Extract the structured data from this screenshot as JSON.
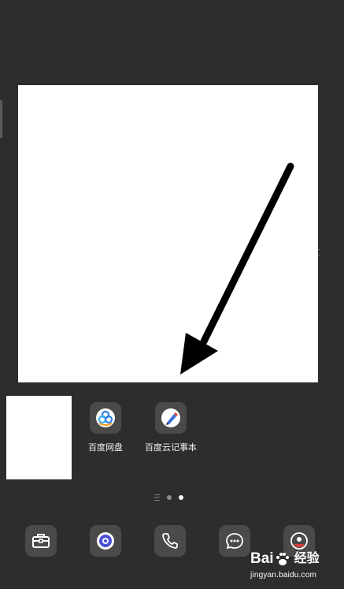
{
  "home_screen": {
    "apps": [
      {
        "label": "百度网盘",
        "icon": "baidu-netdisk-icon"
      },
      {
        "label": "百度云记事本",
        "icon": "baidu-cloud-notepad-icon"
      }
    ],
    "pages": {
      "count": 2,
      "current": 2
    }
  },
  "dock": {
    "items": [
      {
        "icon": "briefcase-icon"
      },
      {
        "icon": "browser-icon"
      },
      {
        "icon": "phone-icon"
      },
      {
        "icon": "messages-icon"
      },
      {
        "icon": "camera-icon"
      }
    ]
  },
  "watermark": {
    "brand_left": "Bai",
    "brand_right": "经验",
    "url": "jingyan.baidu.com"
  },
  "colors": {
    "background": "#2d2e2c",
    "icon_tile": "#4a4b49",
    "arrow": "#000000",
    "page_dot_active": "#ffffff"
  }
}
